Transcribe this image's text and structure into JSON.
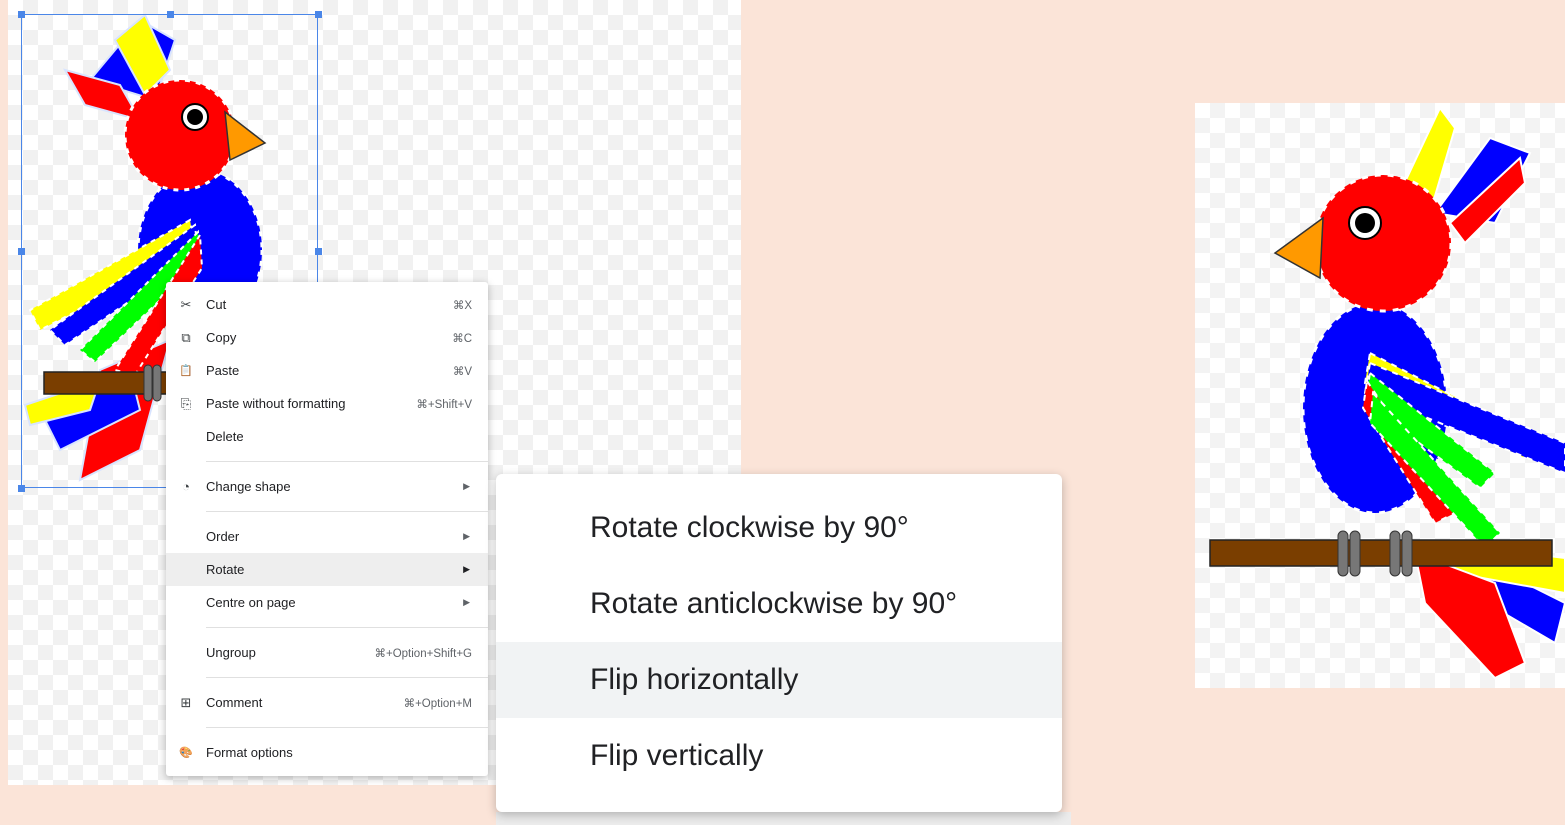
{
  "context_menu": {
    "items": [
      {
        "icon": "scissors-icon",
        "glyph": "✂",
        "label": "Cut",
        "shortcut": "⌘X"
      },
      {
        "icon": "copy-icon",
        "glyph": "⧉",
        "label": "Copy",
        "shortcut": "⌘C"
      },
      {
        "icon": "clipboard-icon",
        "glyph": "📋",
        "label": "Paste",
        "shortcut": "⌘V"
      },
      {
        "icon": "paste-plain-icon",
        "glyph": "⎘",
        "label": "Paste without formatting",
        "shortcut": "⌘+Shift+V"
      },
      {
        "label": "Delete"
      },
      {
        "icon": "shapes-icon",
        "glyph": "◔",
        "label": "Change shape",
        "submenu": true
      },
      {
        "label": "Order",
        "submenu": true
      },
      {
        "label": "Rotate",
        "submenu": true,
        "active": true
      },
      {
        "label": "Centre on page",
        "submenu": true
      },
      {
        "label": "Ungroup",
        "shortcut": "⌘+Option+Shift+G"
      },
      {
        "icon": "comment-icon",
        "glyph": "⊞",
        "label": "Comment",
        "shortcut": "⌘+Option+M"
      },
      {
        "icon": "format-options-icon",
        "glyph": "🎨",
        "label": "Format options"
      }
    ]
  },
  "rotate_submenu": {
    "items": [
      {
        "label": "Rotate clockwise by 90°"
      },
      {
        "label": "Rotate anticlockwise by 90°"
      },
      {
        "label": "Flip horizontally",
        "active": true
      },
      {
        "label": "Flip vertically"
      }
    ]
  },
  "colors": {
    "selection": "#4a86e8",
    "parrot_head": "#ff0000",
    "parrot_body": "#0000ff",
    "feather_yellow": "#ffff00",
    "feather_green": "#00ff00",
    "beak": "#ff9900",
    "perch": "#7a3e00"
  }
}
